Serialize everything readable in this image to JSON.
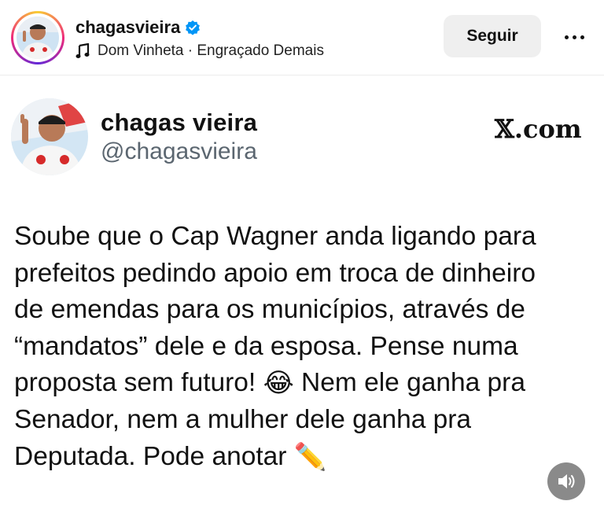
{
  "header": {
    "username": "chagasvieira",
    "verified_icon": "verified-badge-icon",
    "music": "Dom Vinheta · Engraçado Demais",
    "music_icon": "music-note-icon",
    "follow_label": "Seguir",
    "more_icon": "more-options-icon"
  },
  "tweet": {
    "display_name": "chagas vieira",
    "handle": "@chagasvieira",
    "source": "𝕏.com",
    "text_part1": "Soube que o Cap Wagner anda ligando para\nprefeitos pedindo apoio em troca de dinheiro\nde emendas para os municípios, através de\n“mandatos” dele e da esposa. Pense numa\nproposta sem futuro! ",
    "emoji1": "😂",
    "text_part2": " Nem ele ganha pra\nSenador, nem a mulher dele ganha pra\nDeputada. Pode anotar ",
    "emoji2": "✏️"
  },
  "controls": {
    "sound_icon": "speaker-icon"
  },
  "colors": {
    "verified": "#0095f6",
    "follow_bg": "#efefef",
    "handle": "#5b6670",
    "sound_bg": "#8a8a8a"
  }
}
